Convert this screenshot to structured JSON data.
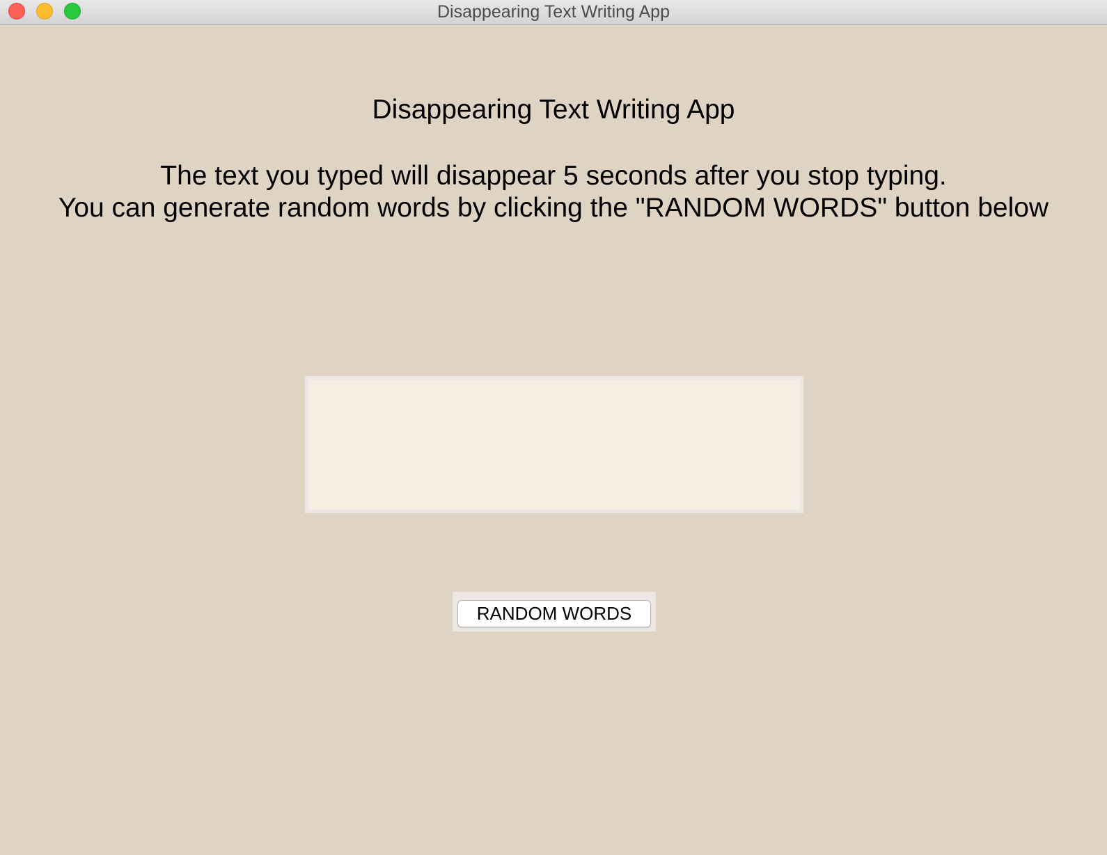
{
  "window": {
    "title": "Disappearing Text Writing App",
    "controls": {
      "close_color": "#fe5f57",
      "minimize_color": "#febc2e",
      "zoom_color": "#28c840"
    }
  },
  "main": {
    "heading": "Disappearing Text Writing App",
    "instructions": {
      "line1": "The text you typed will disappear 5 seconds after you stop typing.",
      "line2": "You can generate random words by clicking the \"RANDOM WORDS\" button below"
    },
    "text_area": {
      "value": ""
    },
    "random_button_label": "RANDOM WORDS"
  },
  "colors": {
    "background": "#dfd4c4",
    "text_area_background": "#f6ede3"
  }
}
